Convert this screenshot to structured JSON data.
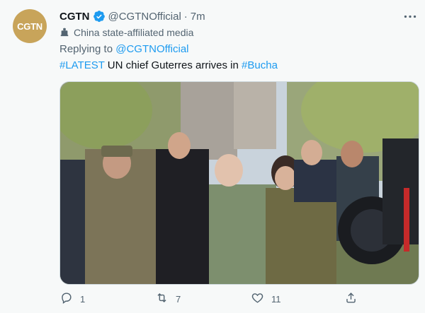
{
  "account": {
    "avatar_text": "CGTN",
    "name": "CGTN",
    "handle": "@CGTNOfficial",
    "separator": "·",
    "time": "7m",
    "affiliation": "China state-affiliated media"
  },
  "reply": {
    "prefix": "Replying to ",
    "mention": "@CGTNOfficial"
  },
  "tweet": {
    "hashtag1": "#LATEST",
    "body": " UN chief Guterres arrives in ",
    "hashtag2": "#Bucha"
  },
  "actions": {
    "replies": "1",
    "retweets": "7",
    "likes": "11"
  },
  "colors": {
    "link": "#1d9bf0",
    "secondary": "#536471",
    "avatar": "#c8a45a"
  }
}
